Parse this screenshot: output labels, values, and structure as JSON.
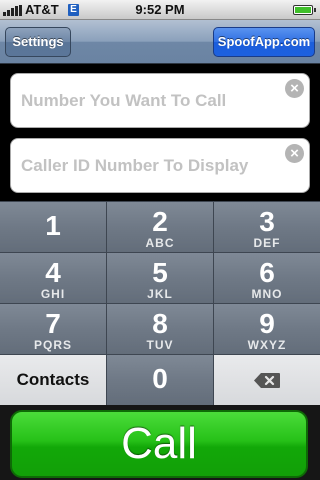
{
  "status_bar": {
    "carrier": "AT&T",
    "network_badge": "E",
    "time": "9:52 PM",
    "signal_icon": "signal-bars-icon",
    "battery_icon": "battery-icon"
  },
  "nav": {
    "left_button": "Settings",
    "right_button": "SpoofApp.com"
  },
  "form": {
    "number_placeholder": "Number You Want To Call",
    "caller_id_placeholder": "Caller ID Number To Display",
    "clear_glyph": "×"
  },
  "keypad": {
    "keys": [
      {
        "digit": "1",
        "letters": ""
      },
      {
        "digit": "2",
        "letters": "ABC"
      },
      {
        "digit": "3",
        "letters": "DEF"
      },
      {
        "digit": "4",
        "letters": "GHI"
      },
      {
        "digit": "5",
        "letters": "JKL"
      },
      {
        "digit": "6",
        "letters": "MNO"
      },
      {
        "digit": "7",
        "letters": "PQRS"
      },
      {
        "digit": "8",
        "letters": "TUV"
      },
      {
        "digit": "9",
        "letters": "WXYZ"
      },
      {
        "digit": "0",
        "letters": ""
      }
    ],
    "contacts_label": "Contacts",
    "backspace_icon": "backspace-icon"
  },
  "call": {
    "label": "Call",
    "color": "#26c118"
  }
}
